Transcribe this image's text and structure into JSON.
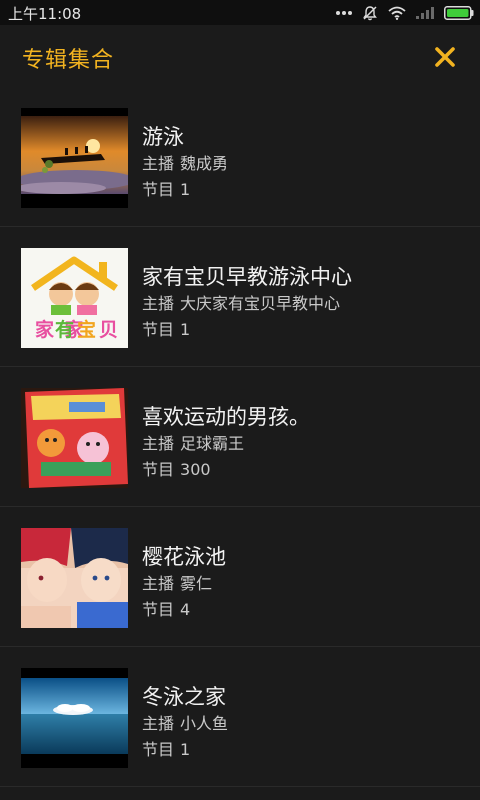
{
  "status_bar": {
    "time": "上午11:08",
    "icons": [
      "more-dots-icon",
      "notification-muted-icon",
      "wifi-icon",
      "signal-icon",
      "battery-icon"
    ]
  },
  "header": {
    "title": "专辑集合",
    "close_icon": "close-icon",
    "accent_color": "#f2b320"
  },
  "albums": [
    {
      "title": "游泳",
      "host_label": "主播",
      "host": "魏成勇",
      "count_label": "节目",
      "count": "1",
      "cover": "sunset-swimming-cover"
    },
    {
      "title": "家有宝贝早教游泳中心",
      "host_label": "主播",
      "host": "大庆家有宝贝早教中心",
      "count_label": "节目",
      "count": "1",
      "cover": "baby-logo-cover"
    },
    {
      "title": "喜欢运动的男孩。",
      "host_label": "主播",
      "host": "足球霸王",
      "count_label": "节目",
      "count": "300",
      "cover": "picture-book-cover"
    },
    {
      "title": "樱花泳池",
      "host_label": "主播",
      "host": "雾仁",
      "count_label": "节目",
      "count": "4",
      "cover": "anime-boys-cover"
    },
    {
      "title": "冬泳之家",
      "host_label": "主播",
      "host": "小人鱼",
      "count_label": "节目",
      "count": "1",
      "cover": "sea-sky-cover"
    }
  ]
}
